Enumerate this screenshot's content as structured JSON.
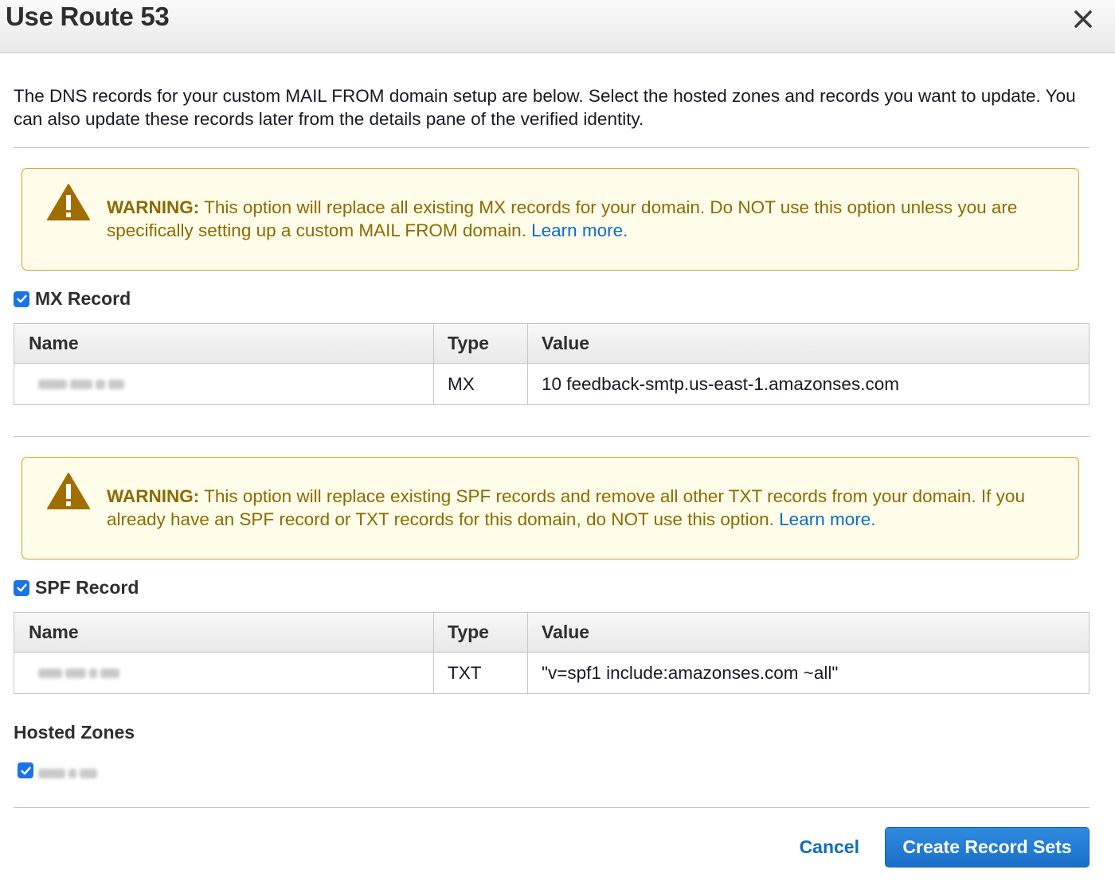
{
  "dialog": {
    "title": "Use Route 53",
    "close_icon": "close-icon",
    "intro": "The DNS records for your custom MAIL FROM domain setup are below. Select the hosted zones and records you want to update. You can also update these records later from the details pane of the verified identity."
  },
  "warnings": [
    {
      "label": "WARNING:",
      "text": " This option will replace all existing MX records for your domain. Do NOT use this option unless you are specifically setting up a custom MAIL FROM domain. ",
      "link": "Learn more."
    },
    {
      "label": "WARNING:",
      "text": " This option will replace existing SPF records and remove all other TXT records from your domain. If you already have an SPF record or TXT records for this domain, do NOT use this option. ",
      "link": "Learn more."
    }
  ],
  "mx_record": {
    "label": "MX Record",
    "checked": true,
    "columns": [
      "Name",
      "Type",
      "Value"
    ],
    "row": {
      "type": "MX",
      "value": "10 feedback-smtp.us-east-1.amazonses.com"
    }
  },
  "spf_record": {
    "label": "SPF Record",
    "checked": true,
    "columns": [
      "Name",
      "Type",
      "Value"
    ],
    "row": {
      "type": "TXT",
      "value": "\"v=spf1 include:amazonses.com ~all\""
    }
  },
  "hosted_zones": {
    "heading": "Hosted Zones",
    "checked": true
  },
  "footer": {
    "cancel": "Cancel",
    "submit": "Create Record Sets"
  },
  "colors": {
    "warning_bg": "#fffce9",
    "warning_border": "#d3a421",
    "warning_text": "#8b6a00",
    "link": "#0b6dc4",
    "primary": "#1a73e8"
  }
}
